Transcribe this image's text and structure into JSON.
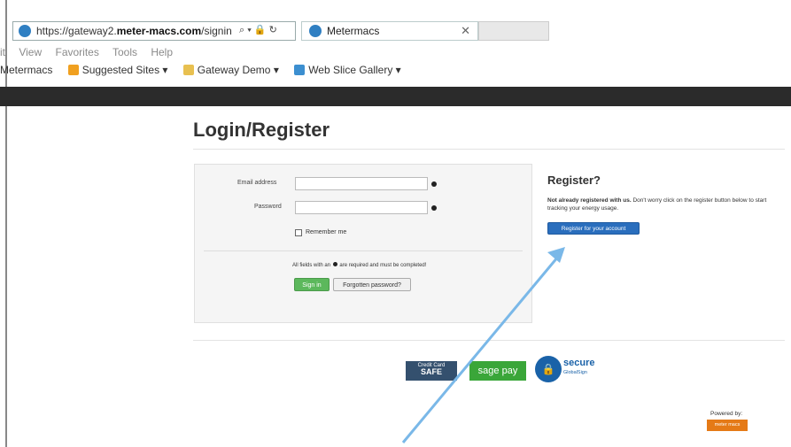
{
  "browser": {
    "url_scheme": "https://",
    "url_host_prefix": "gateway2.",
    "url_host_main": "meter-macs.com",
    "url_path": "/signin",
    "url_controls": "⌕ ▾ 🔒 ↻",
    "tab_title": "Metermacs",
    "tab_close": "✕",
    "menu": [
      "it",
      "View",
      "Favorites",
      "Tools",
      "Help"
    ],
    "favorites": [
      {
        "label": "Metermacs",
        "color": "#ffffff"
      },
      {
        "label": "Suggested Sites ▾",
        "color": "#f0a020"
      },
      {
        "label": "Gateway Demo ▾",
        "color": "#e8c050"
      },
      {
        "label": "Web Slice Gallery ▾",
        "color": "#3c8fd0"
      }
    ]
  },
  "page": {
    "title": "Login/Register",
    "login": {
      "email_label": "Email address",
      "password_label": "Password",
      "remember_label": "Remember me",
      "required_note_before": "All fields with an",
      "required_note_after": "are required and must be completed!",
      "signin_label": "Sign in",
      "forgot_label": "Forgotten password?"
    },
    "register": {
      "title": "Register?",
      "text_bold": "Not already registered with us.",
      "text_rest": " Don't worry click on the register button below to start tracking your energy usage.",
      "button_label": "Register for your account"
    },
    "logos": {
      "cc_small": "Credit Card",
      "cc_big": "SAFE",
      "sage": "sage pay",
      "secure": "secure",
      "secure_sub": "GlobalSign"
    },
    "powered_by": "Powered by:",
    "powered_logo": "meter macs"
  },
  "colors": {
    "annotation_arrow": "#7ab8e8",
    "register_button": "#2a6ebd",
    "signin_button": "#5cb85c"
  }
}
